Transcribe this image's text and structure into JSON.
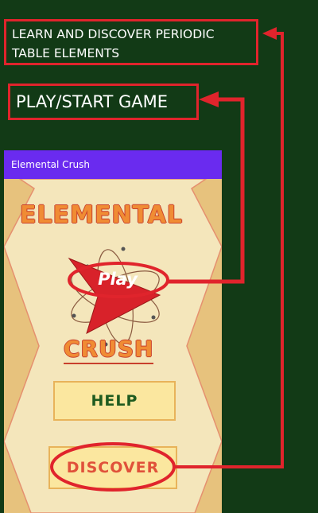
{
  "callouts": {
    "discover": "LEARN AND DISCOVER PERIODIC TABLE ELEMENTS",
    "play": "PLAY/START GAME"
  },
  "app": {
    "title": "Elemental Crush",
    "logo_top": "ELEMENTAL",
    "logo_bottom": "CRUSH",
    "play_label": "Play",
    "help_label": "HELP",
    "discover_label": "DISCOVER"
  },
  "icons": {
    "atom": "atom-icon",
    "play": "play-triangle-icon",
    "arrow": "arrow-connector-icon"
  },
  "colors": {
    "background": "#123a16",
    "annotation": "#e0242c",
    "app_bar": "#6a2bef",
    "button_fill": "#fbe79f",
    "title_orange": "#f08c34"
  }
}
